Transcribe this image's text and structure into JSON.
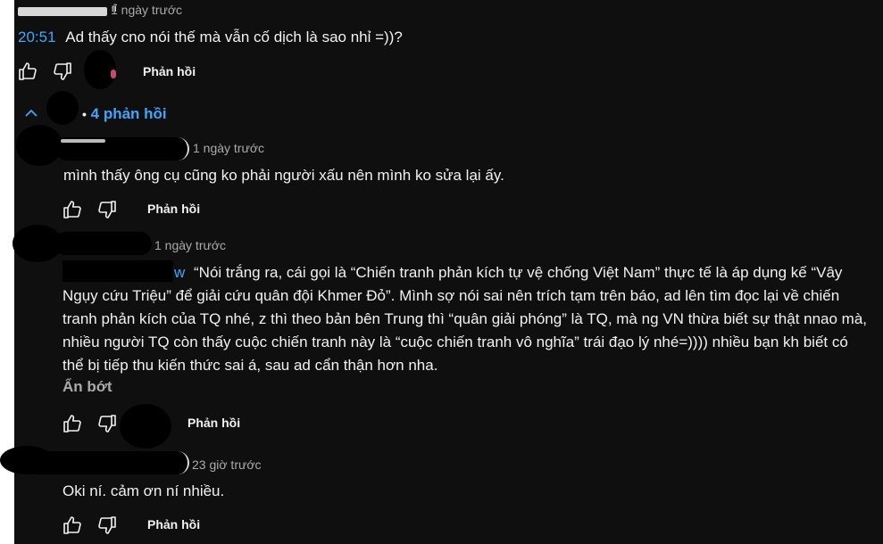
{
  "top_comment": {
    "author_fragment": "ıĩ",
    "time": "1 ngày trước",
    "timestamp": "20:51",
    "text": "Ad thấy cno nói thế mà vẫn cố dịch là sao nhỉ =))?",
    "reply_label": "Phản hồi"
  },
  "replies_toggle": {
    "separator": "•",
    "label": "4 phản hồi"
  },
  "replies": [
    {
      "time": "1 ngày trước",
      "text": "mình thấy ông cụ cũng ko phải người  xấu nên mình ko sửa lại ấy.",
      "reply_label": "Phản hồi"
    },
    {
      "time": "1 ngày trước",
      "mention_tail": "w",
      "text": "“Nói trắng ra, cái gọi là “Chiến tranh phản kích tự vệ chống Việt Nam” thực tế là áp dụng kế “Vây Ngụy cứu Triệu” để giải cứu quân đội Khmer Đỏ”. Mình sợ nói sai nên trích tạm trên báo, ad lên tìm đọc lại về chiến tranh phản kích của TQ nhé, z thì theo bản bên Trung thì “quân giải phóng” là TQ, mà ng VN thừa biết sự thật nnao mà, nhiều người TQ còn thấy cuộc chiến tranh này là “cuộc chiến tranh vô nghĩa” trái đạo lý nhé=)))) nhiều bạn kh biết có thể bị tiếp thu kiến thức sai á, sau ad cẩn thận hơn nha.",
      "collapse_label": "Ẩn bớt",
      "reply_label": "Phản hồi"
    },
    {
      "time": "23 giờ trước",
      "text": "Oki ní. cảm ơn ní nhiều.",
      "reply_label": "Phản hồi"
    }
  ],
  "colors": {
    "background": "#0f0f0f",
    "text": "#f1f1f1",
    "meta": "#aaaaaa",
    "link": "#3ea6ff"
  }
}
